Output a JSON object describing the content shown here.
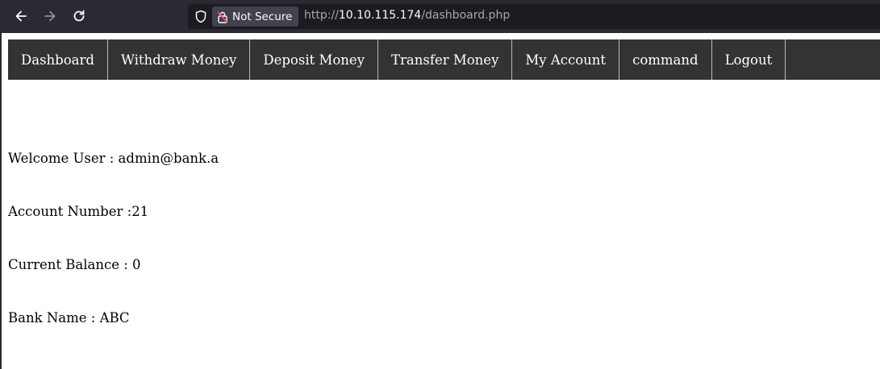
{
  "browser": {
    "security_label": "Not Secure",
    "url_protocol": "http://",
    "url_host": "10.10.115.174",
    "url_path": "/dashboard.php"
  },
  "menu": {
    "items": [
      {
        "label": "Dashboard"
      },
      {
        "label": "Withdraw Money"
      },
      {
        "label": "Deposit Money"
      },
      {
        "label": "Transfer Money"
      },
      {
        "label": "My Account"
      },
      {
        "label": "command"
      },
      {
        "label": "Logout"
      }
    ]
  },
  "account": {
    "welcome": "Welcome User : admin@bank.a",
    "account_number": "Account Number :21",
    "balance": "Current Balance : 0",
    "bank_name": "Bank Name : ABC"
  },
  "colors": {
    "chrome_bg": "#2b2a33",
    "menu_bg": "#333333",
    "page_bg": "#ffffff"
  }
}
